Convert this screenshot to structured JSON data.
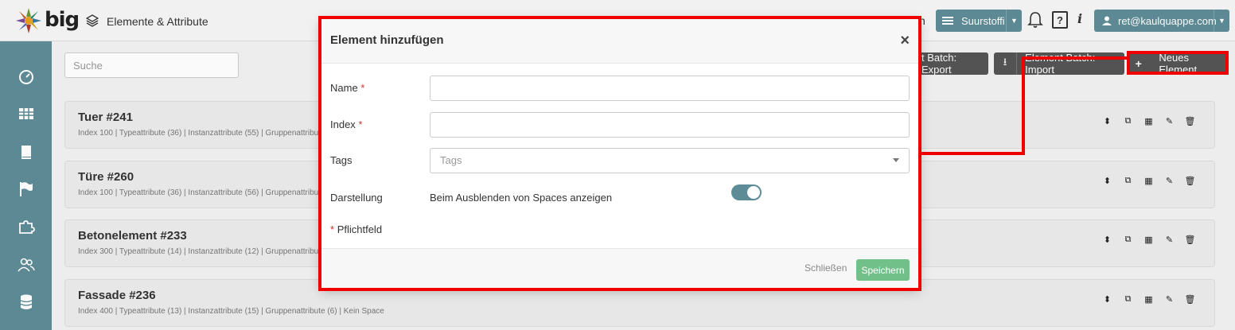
{
  "header": {
    "brand": "big",
    "page_title": "Elemente & Attribute",
    "trailing_text": "n",
    "space_selector": "Suurstoffi",
    "user": "ret@kaulquappe.com"
  },
  "toolbar": {
    "search_placeholder": "Suche",
    "export_label": "t Batch: Export",
    "import_label": "Element Batch: Import",
    "new_label": "Neues Element"
  },
  "cards": [
    {
      "title": "Tuer #241",
      "meta": "Index 100 | Typeattribute (36) | Instanzattribute (55) | Gruppenattribu"
    },
    {
      "title": "Türe #260",
      "meta": "Index 100 | Typeattribute (36) | Instanzattribute (56) | Gruppenattribu"
    },
    {
      "title": "Betonelement #233",
      "meta": "Index 300 | Typeattribute (14) | Instanzattribute (12) | Gruppenattribu"
    },
    {
      "title": "Fassade #236",
      "meta": "Index 400 | Typeattribute (13) | Instanzattribute (15) | Gruppenattribute (6) | Kein Space"
    }
  ],
  "modal": {
    "title": "Element hinzufügen",
    "close_symbol": "×",
    "fields": {
      "name_label": "Name",
      "index_label": "Index",
      "tags_label": "Tags",
      "tags_placeholder": "Tags",
      "display_label": "Darstellung",
      "display_option": "Beim Ausblenden von Spaces anzeigen",
      "required_marker": "*",
      "required_note": "Pflichtfeld"
    },
    "toggle_on": true,
    "close_button": "Schließen",
    "save_button": "Speichern"
  },
  "colors": {
    "accent": "#5e8c96",
    "save": "#71c08a",
    "highlight": "#ee0000"
  }
}
